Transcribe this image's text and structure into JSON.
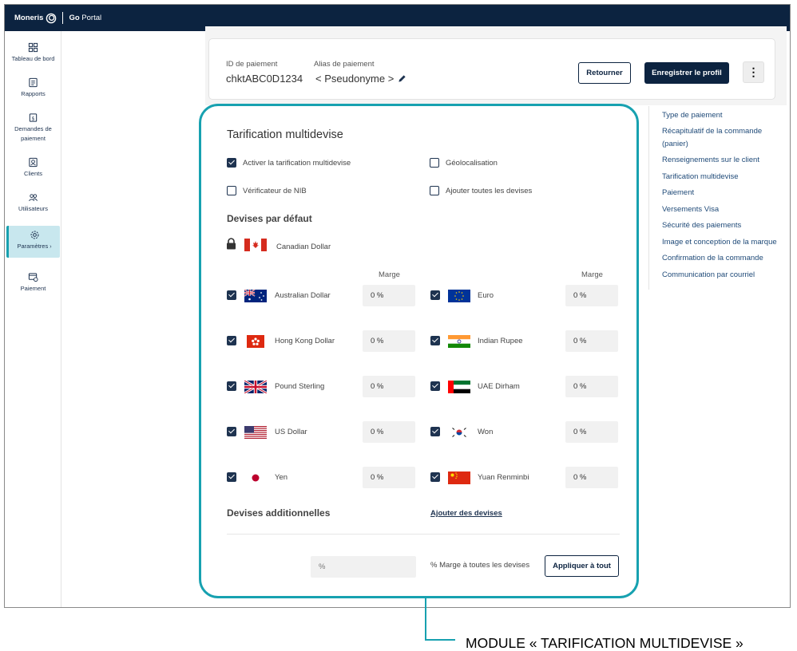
{
  "app": {
    "brand": "Moneris",
    "portal_prefix": "Go",
    "portal_suffix": " Portal"
  },
  "sidebar": {
    "items": [
      {
        "label": "Tableau de bord",
        "icon": "dashboard-icon"
      },
      {
        "label": "Rapports",
        "icon": "reports-icon"
      },
      {
        "label": "Demandes de paiement",
        "icon": "payment-requests-icon"
      },
      {
        "label": "Clients",
        "icon": "clients-icon"
      },
      {
        "label": "Utilisateurs",
        "icon": "users-icon"
      },
      {
        "label": "Paramètres",
        "icon": "gear-icon",
        "caret": "›",
        "active": true
      },
      {
        "label": "Paiement",
        "icon": "payment-icon"
      }
    ]
  },
  "header": {
    "id_label": "ID de paiement",
    "id_value": "chktABC0D1234",
    "alias_label": "Alias de paiement",
    "alias_value": "< Pseudonyme >",
    "back_button": "Retourner",
    "save_button": "Enregistrer le profil",
    "more_button": "⋮"
  },
  "toc": [
    "Type de paiement",
    "Récapitulatif de la commande (panier)",
    "Renseignements sur le client",
    "Tarification multidevise",
    "Paiement",
    "Versements Visa",
    "Sécurité des paiements",
    "Image et conception de la marque",
    "Confirmation de la commande",
    "Communication par courriel"
  ],
  "module": {
    "title": "Tarification multidevise",
    "options": [
      {
        "label": "Activer la tarification multidevise",
        "checked": true
      },
      {
        "label": "Géolocalisation",
        "checked": false
      },
      {
        "label": "Vérificateur de NIB",
        "checked": false
      },
      {
        "label": "Ajouter toutes les devises",
        "checked": false
      }
    ],
    "default_title": "Devises par défaut",
    "locked_currency": "Canadian Dollar",
    "marge_header": "Marge",
    "currencies": [
      {
        "name": "Australian Dollar",
        "flag": "au",
        "margin": "0 %",
        "checked": true
      },
      {
        "name": "Euro",
        "flag": "eu",
        "margin": "0 %",
        "checked": true
      },
      {
        "name": "Hong Kong Dollar",
        "flag": "hk",
        "margin": "0 %",
        "checked": true
      },
      {
        "name": "Indian Rupee",
        "flag": "in",
        "margin": "0 %",
        "checked": true
      },
      {
        "name": "Pound Sterling",
        "flag": "gb",
        "margin": "0 %",
        "checked": true
      },
      {
        "name": "UAE Dirham",
        "flag": "ae",
        "margin": "0 %",
        "checked": true
      },
      {
        "name": "US Dollar",
        "flag": "us",
        "margin": "0 %",
        "checked": true
      },
      {
        "name": "Won",
        "flag": "kr",
        "margin": "0 %",
        "checked": true
      },
      {
        "name": "Yen",
        "flag": "jp",
        "margin": "0 %",
        "checked": true
      },
      {
        "name": "Yuan Renminbi",
        "flag": "cn",
        "margin": "0 %",
        "checked": true
      }
    ],
    "additional_title": "Devises additionnelles",
    "add_link": "Ajouter des devises",
    "all_margin_placeholder": "%",
    "all_margin_label": "% Marge à toutes les devises",
    "apply_button": "Appliquer à tout"
  },
  "callout": "MODULE « TARIFICATION MULTIDEVISE »",
  "colors": {
    "navy": "#0c2340",
    "teal": "#17a1b0",
    "link": "#1f4a78",
    "active_bg": "#c8e7ee"
  }
}
